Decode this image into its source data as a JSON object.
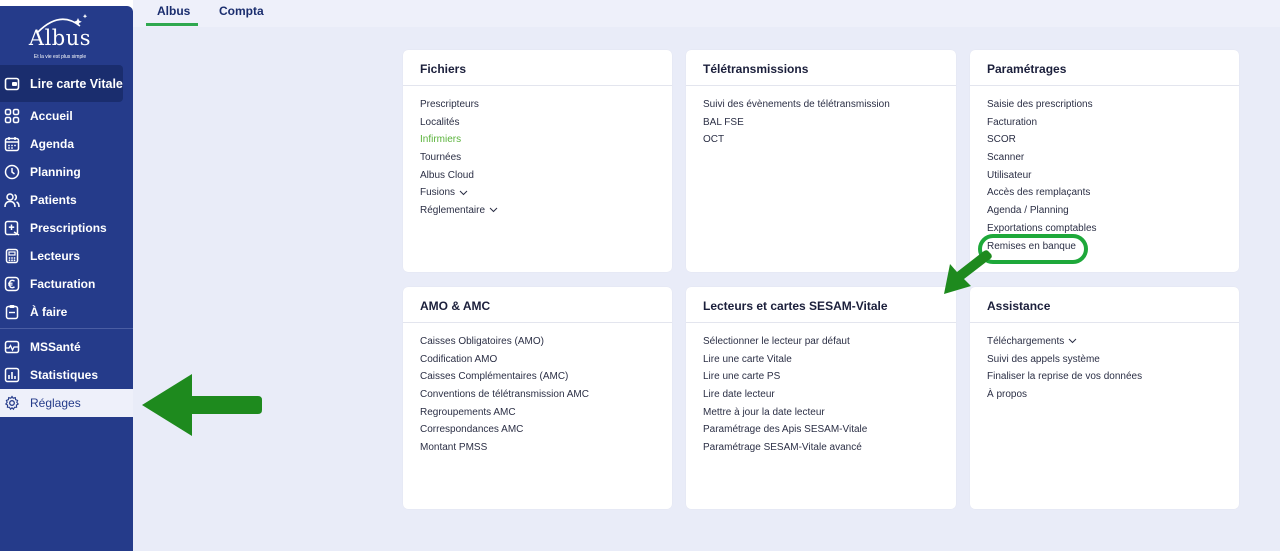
{
  "logo": {
    "name": "Albus",
    "tagline": "Et la vie est plus simple"
  },
  "sidebar": {
    "vitale_label": "Lire carte Vitale",
    "items": [
      {
        "label": "Accueil",
        "icon": "grid-icon"
      },
      {
        "label": "Agenda",
        "icon": "calendar-icon"
      },
      {
        "label": "Planning",
        "icon": "clock-icon"
      },
      {
        "label": "Patients",
        "icon": "users-icon"
      },
      {
        "label": "Prescriptions",
        "icon": "prescription-icon"
      },
      {
        "label": "Lecteurs",
        "icon": "card-reader-icon"
      },
      {
        "label": "Facturation",
        "icon": "euro-icon"
      },
      {
        "label": "À faire",
        "icon": "clipboard-icon"
      },
      {
        "label": "MSSanté",
        "icon": "mail-icon"
      },
      {
        "label": "Statistiques",
        "icon": "chart-icon"
      },
      {
        "label": "Réglages",
        "icon": "gear-icon"
      }
    ],
    "active": "Réglages"
  },
  "tabs": [
    {
      "label": "Albus",
      "active": true
    },
    {
      "label": "Compta",
      "active": false
    }
  ],
  "cards": [
    {
      "title": "Fichiers",
      "items": [
        "Prescripteurs",
        "Localités",
        "Infirmiers",
        "Tournées",
        "Albus Cloud",
        "Fusions",
        "Réglementaire"
      ]
    },
    {
      "title": "Télétransmissions",
      "items": [
        "Suivi des évènements de télétransmission",
        "BAL FSE",
        "OCT"
      ]
    },
    {
      "title": "Paramétrages",
      "items": [
        "Saisie des prescriptions",
        "Facturation",
        "SCOR",
        "Scanner",
        "Utilisateur",
        "Accès des remplaçants",
        "Agenda / Planning",
        "Exportations comptables",
        "Remises en banque"
      ]
    },
    {
      "title": "AMO & AMC",
      "items": [
        "Caisses Obligatoires (AMO)",
        "Codification AMO",
        "Caisses Complémentaires (AMC)",
        "Conventions de télétransmission AMC",
        "Regroupements AMC",
        "Correspondances AMC",
        "Montant PMSS"
      ]
    },
    {
      "title": "Lecteurs et cartes SESAM-Vitale",
      "items": [
        "Sélectionner le lecteur par défaut",
        "Lire une carte Vitale",
        "Lire une carte PS",
        "Lire date lecteur",
        "Mettre à jour la date lecteur",
        "Paramétrage des Apis SESAM-Vitale",
        "Paramétrage SESAM-Vitale avancé"
      ]
    },
    {
      "title": "Assistance",
      "items": [
        "Téléchargements",
        "Suivi des appels système",
        "Finaliser la reprise de vos données",
        "À propos"
      ]
    }
  ],
  "colors": {
    "sidebar": "#253b8a",
    "accent_green": "#2fa84f",
    "annotation_green": "#1e8a1e",
    "background": "#e9ecf8"
  }
}
